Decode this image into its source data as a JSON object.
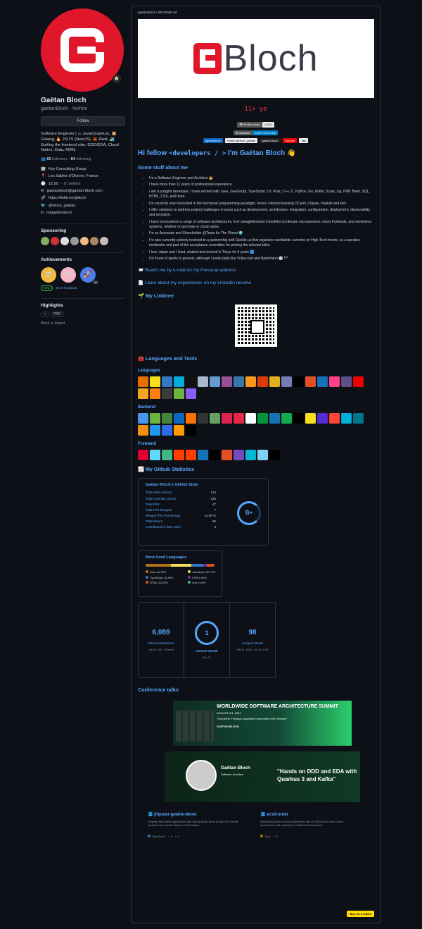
{
  "profile": {
    "name": "Gaëtan Bloch",
    "username": "gaetanBloch · he/him",
    "follow_label": "Follow",
    "bio": "Software Engineer | ☕ Java(Quarkus), 🐹 Golang, 🔥 JS/TS (NestJS), 🦀 Rust, 🏄 Surfing the frontend vibe, DDD/EDA, Cloud Native, Data, AI/ML",
    "followers_count": "82",
    "followers_label": "followers",
    "following_count": "84",
    "following_label": "following",
    "company": "Key Consulting Group",
    "location": "Les Sables d'Olonne, France",
    "time": "12:20",
    "time_note": "- 1h behind",
    "email": "gaetanbloch@gaetan-bloch.com",
    "website": "https://linktr.ee/gbloch",
    "twitter": "@bloch_gaetan",
    "linkedin": "in/gaetanbloch"
  },
  "sections": {
    "sponsoring": "Sponsoring",
    "achievements": "Achievements",
    "beta_badge": "Beta",
    "send_feedback": "Send feedback",
    "highlights": "Highlights",
    "pro_badge": "PRO",
    "block": "Block or Report",
    "ach_count": "x2"
  },
  "readme": {
    "path": "gaetanBloch / README.md",
    "banner_text": "Bloch",
    "typing": "11+ ye",
    "views_label": "👁 Profile Views",
    "views_value": "19262",
    "wakatime_label": "⏱ wakatime",
    "wakatime_value": "3,327 hrs 9 mins",
    "badges": [
      "gaetanbloch",
      "Follow @bloch_gaetan",
      "gaetan-bloch",
      "Youtube",
      "Talk"
    ],
    "greeting_a": "Hi fellow ",
    "greeting_code": "<developers / >",
    "greeting_b": " I'm Gaëtan Bloch 👋",
    "about_title": "Some stuff about me",
    "about": [
      "I'm a Software Engineer and Architect 🧑",
      "I have more than 11 years of professional experience",
      "I am a polyglot developer; I have worked with Java, JavaScript, TypeScript, C#, Rust, C++, C, Python, Go, Kotlin, Scala, Zig, PHP, Bash, SQL, HTML, CSS, and more.",
      "I'm currently very interested in the functional programming paradigm, hence I started learning OCaml, Clojure, Haskell and Elm",
      "I offer solutions to address project challenges in areas such as development, architecture, integration, configuration, deployment, observability, and evolution.",
      "I have encountered a range of software architectures, from straightforward monoliths to intricate microservices, micro frontends, and serverless systems, whether on-premise or cloud native.",
      "I'm an Associate and Shareholder @Team for The Planet 🌍",
      "I'm also currently actively involved in a partnership with Geekle.us that organizes worldwide summits on High-Tech trends, as a speaker, moderator and part of the acceptance committee for picking the relevant talks.",
      "I love Japan and I lived, studied and worked in Tokyo for 6 years 🗾",
      "I'm found of sports in general, although I particularly like Volley-ball and Badminton 🏐 🏸"
    ],
    "mail_link": "📨 Reach me by e-mail on my Personal address",
    "linkedin_link": "📄 Learn about my experiences on my LinkedIn resume",
    "linktree": "🌱 My Linktree",
    "langtools": "🧰 Languages and Tools",
    "languages": "Languages",
    "backend": "Backend",
    "frontend": "Frontend",
    "stats_title": "📈 My Github Statistics",
    "stats_card_title": "Gaëtan Bloch's GitHub Stats",
    "stats": [
      {
        "label": "Total Stars Earned:",
        "value": "134"
      },
      {
        "label": "Total Commits (2023):",
        "value": "226"
      },
      {
        "label": "Total PRs:",
        "value": "47"
      },
      {
        "label": "Total PRs Merged:",
        "value": "7"
      },
      {
        "label": "Merged PRs Percentage:",
        "value": "14.89 %"
      },
      {
        "label": "Total Issues:",
        "value": "66"
      },
      {
        "label": "Contributed to (last year):",
        "value": "3"
      }
    ],
    "grade": "B+",
    "mul_title": "Most Used Languages",
    "mul": [
      {
        "name": "Java 36.78%",
        "color": "#b07219"
      },
      {
        "name": "JavaScript 30.72%",
        "color": "#f1e05a"
      },
      {
        "name": "TypeScript 16.64%",
        "color": "#3178c6"
      },
      {
        "name": "CSS 6.04%",
        "color": "#663399"
      },
      {
        "name": "HTML 10.53%",
        "color": "#e34c26"
      },
      {
        "name": "Vue 0.34%",
        "color": "#41b883"
      }
    ],
    "streak": {
      "total": "6,089",
      "total_label": "Total Contributions",
      "total_range": "Jan 20, 2011 - Present",
      "current": "1",
      "current_label": "Current Streak",
      "current_range": "Nov 11",
      "longest": "98",
      "longest_label": "Longest Streak",
      "longest_range": "Mar 11, 2018 - Jun 16, 2018"
    },
    "talks_title": "Conference talks",
    "talk1_title": "WORLDWIDE SOFTWARE ARCHITECTURE SUMMIT",
    "talk1_date": "AUGUST 3-4, 2021",
    "talk1_sub": "\"Monolithic Fullstack application generated with JHipster\"",
    "talk1_name": "GAËTAN BLOCH",
    "talk2_name": "Gaëtan Bloch",
    "talk2_role": "Software Architect",
    "talk2_title": "\"Hands on DDD and EDA with Quarkus 3 and Kafka\"",
    "pins": [
      {
        "title": "jhipster-geekle-demo",
        "desc": "JHipster Monolithic application with Spring Boot Demo project for Geekle Architecture summit Volume Presentation",
        "lang": "TypeScript",
        "lang_color": "#3178c6",
        "stars": "0",
        "forks": "4"
      },
      {
        "title": "ecsd-order",
        "desc": "Repository demo for the conference talk on DDD and Event-Driven Architecture with Quarkus 3, Kafka and Debezium",
        "lang": "Java",
        "lang_color": "#b07219",
        "stars": "8",
        "forks": ""
      }
    ],
    "coffee": "Buy me a coffee"
  },
  "icon_colors": {
    "languages": [
      "#e76f00",
      "#f7df1e",
      "#3178c6",
      "#00add8",
      "#111",
      "#a8b9cc",
      "#659ad2",
      "#9b4f96",
      "#3776ab",
      "#f89820",
      "#dd3a0a",
      "#e0b020",
      "#777bb4",
      "#000",
      "#e34f26",
      "#1572b6",
      "#ff4088",
      "#5e5086",
      "#ee0000",
      "#f7a41d",
      "#ff7f0e",
      "#3c3c3c",
      "#6db33f",
      "#8a5cf6"
    ],
    "backend": [
      "#4695eb",
      "#6db33f",
      "#43853d",
      "#0a66c2",
      "#ff6f00",
      "#333",
      "#68a063",
      "#e0234e",
      "#ea2845",
      "#fff",
      "#009639",
      "#1572b6",
      "#13aa52",
      "#000",
      "#f7df1e",
      "#512bd4",
      "#ff4438",
      "#00add8",
      "#00758f",
      "#f29111",
      "#2496ed",
      "#326ce5",
      "#ff9900",
      "#000"
    ],
    "frontend": [
      "#dd0031",
      "#61dafb",
      "#41b883",
      "#ff3e00",
      "#ff3e00",
      "#1572b6",
      "#000",
      "#e34f26",
      "#764abc",
      "#06b6d4",
      "#7dd3fc",
      "#000"
    ]
  }
}
